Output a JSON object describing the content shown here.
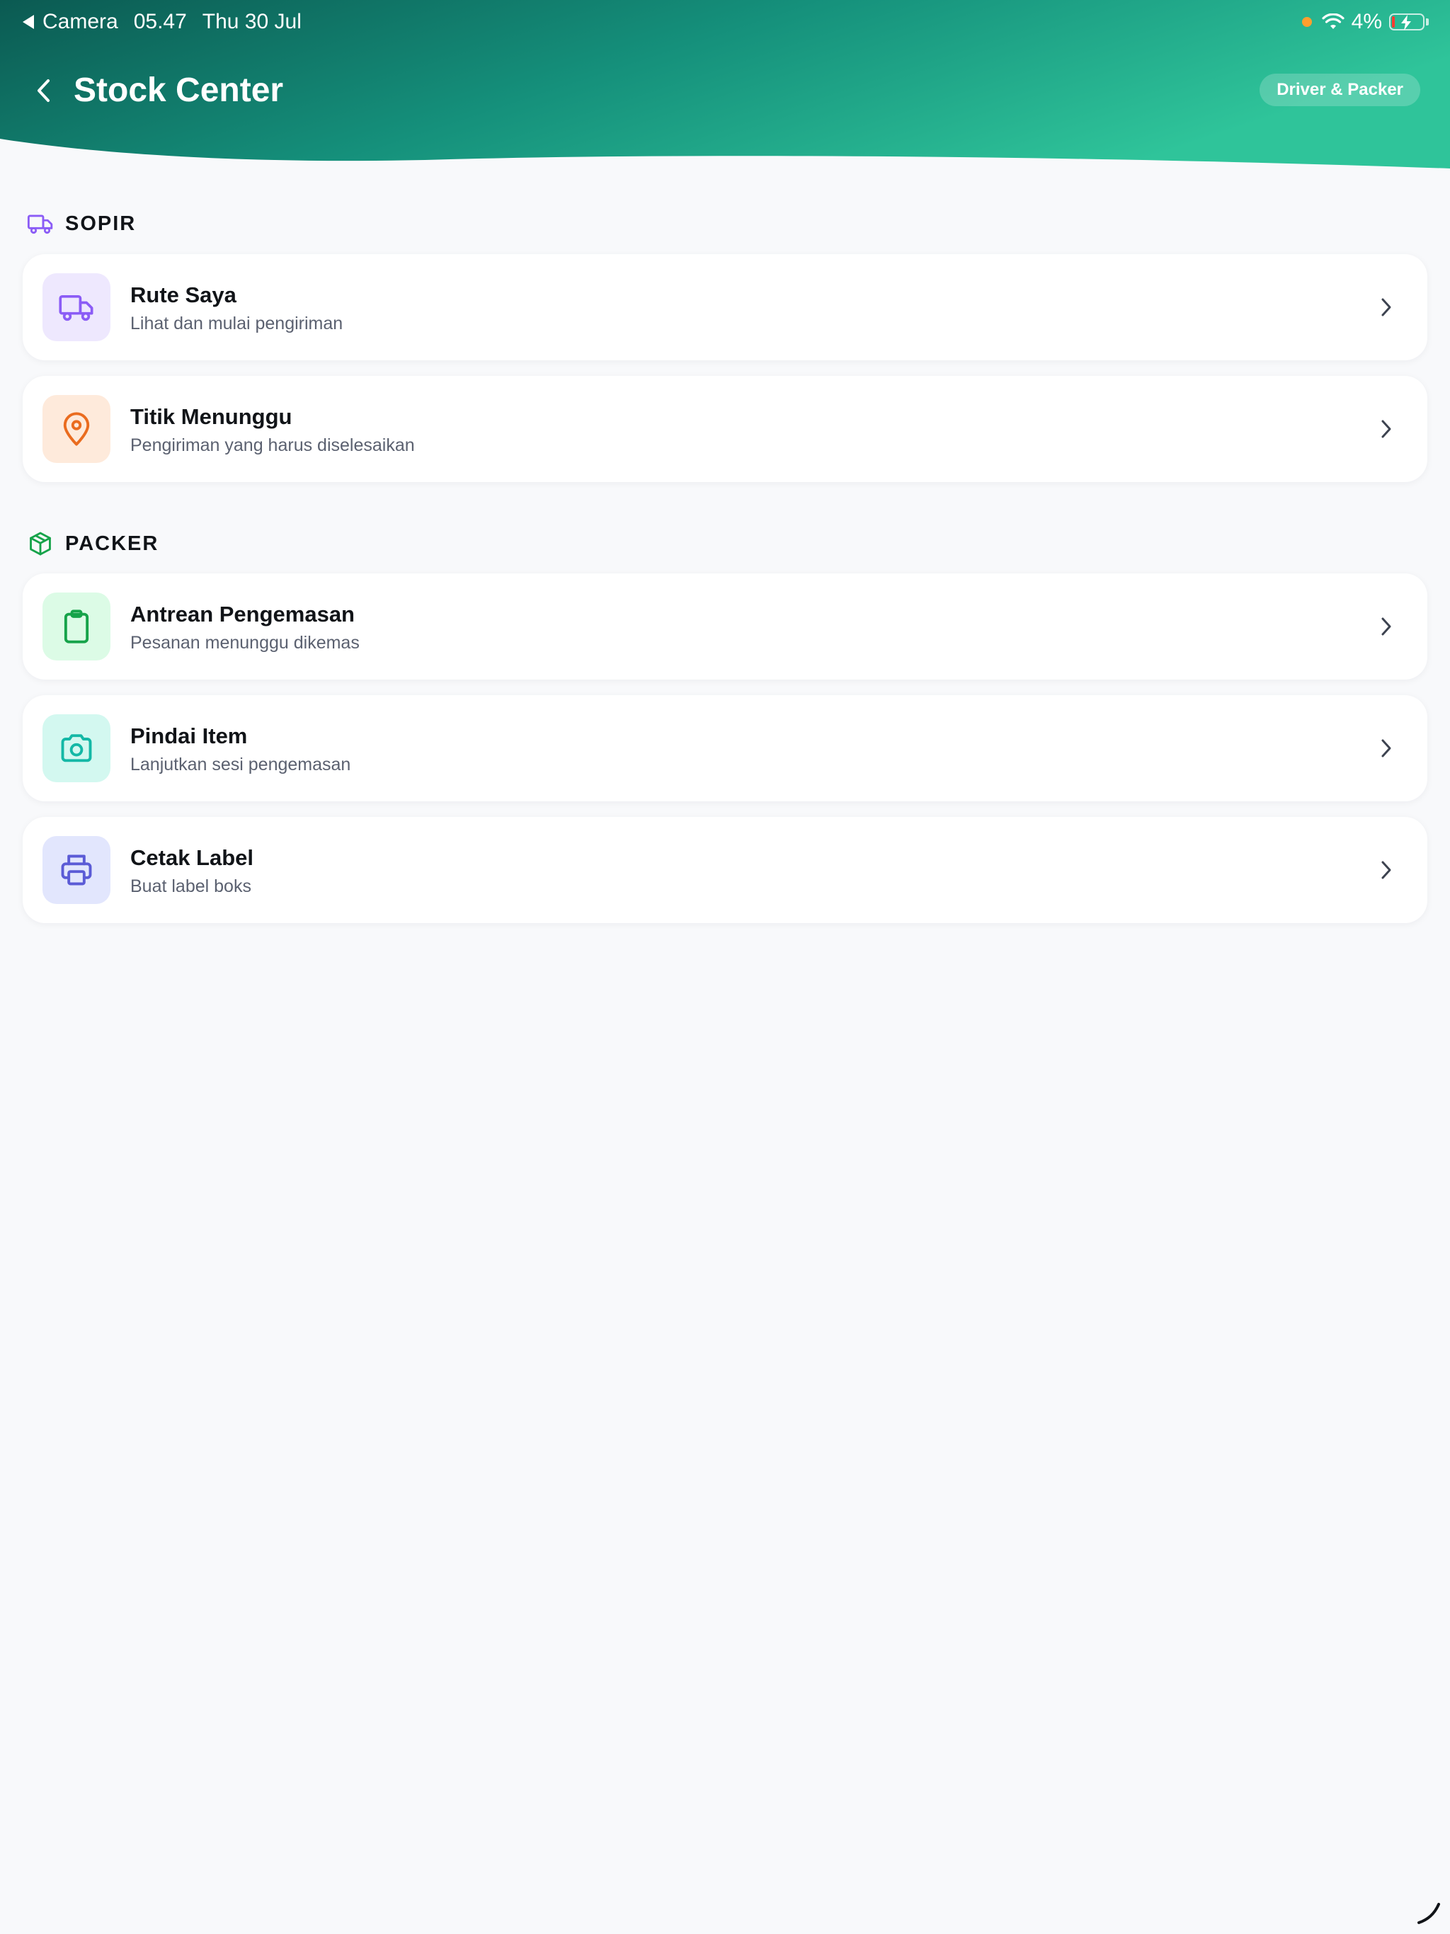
{
  "status_bar": {
    "back_app": "Camera",
    "time": "05.47",
    "date": "Thu 30 Jul",
    "battery": "4%"
  },
  "header": {
    "title": "Stock Center",
    "role_badge": "Driver & Packer"
  },
  "colors": {
    "header_gradient_start": "#0b5f54",
    "header_gradient_end": "#2cc198",
    "background": "#f8f9fb",
    "purple": "#8b5cf6",
    "orange": "#ea6c1f",
    "green": "#16a34a",
    "teal": "#14b8a6",
    "indigo": "#5b5bd6"
  },
  "sections": {
    "sopir": {
      "title": "SOPIR",
      "icon": "truck-icon",
      "items": [
        {
          "title": "Rute Saya",
          "subtitle": "Lihat dan mulai pengiriman",
          "icon": "truck-icon"
        },
        {
          "title": "Titik Menunggu",
          "subtitle": "Pengiriman yang harus diselesaikan",
          "icon": "map-pin-icon"
        }
      ]
    },
    "packer": {
      "title": "PACKER",
      "icon": "package-icon",
      "items": [
        {
          "title": "Antrean Pengemasan",
          "subtitle": "Pesanan menunggu dikemas",
          "icon": "clipboard-icon"
        },
        {
          "title": "Pindai Item",
          "subtitle": "Lanjutkan sesi pengemasan",
          "icon": "camera-icon"
        },
        {
          "title": "Cetak Label",
          "subtitle": "Buat label boks",
          "icon": "printer-icon"
        }
      ]
    }
  }
}
